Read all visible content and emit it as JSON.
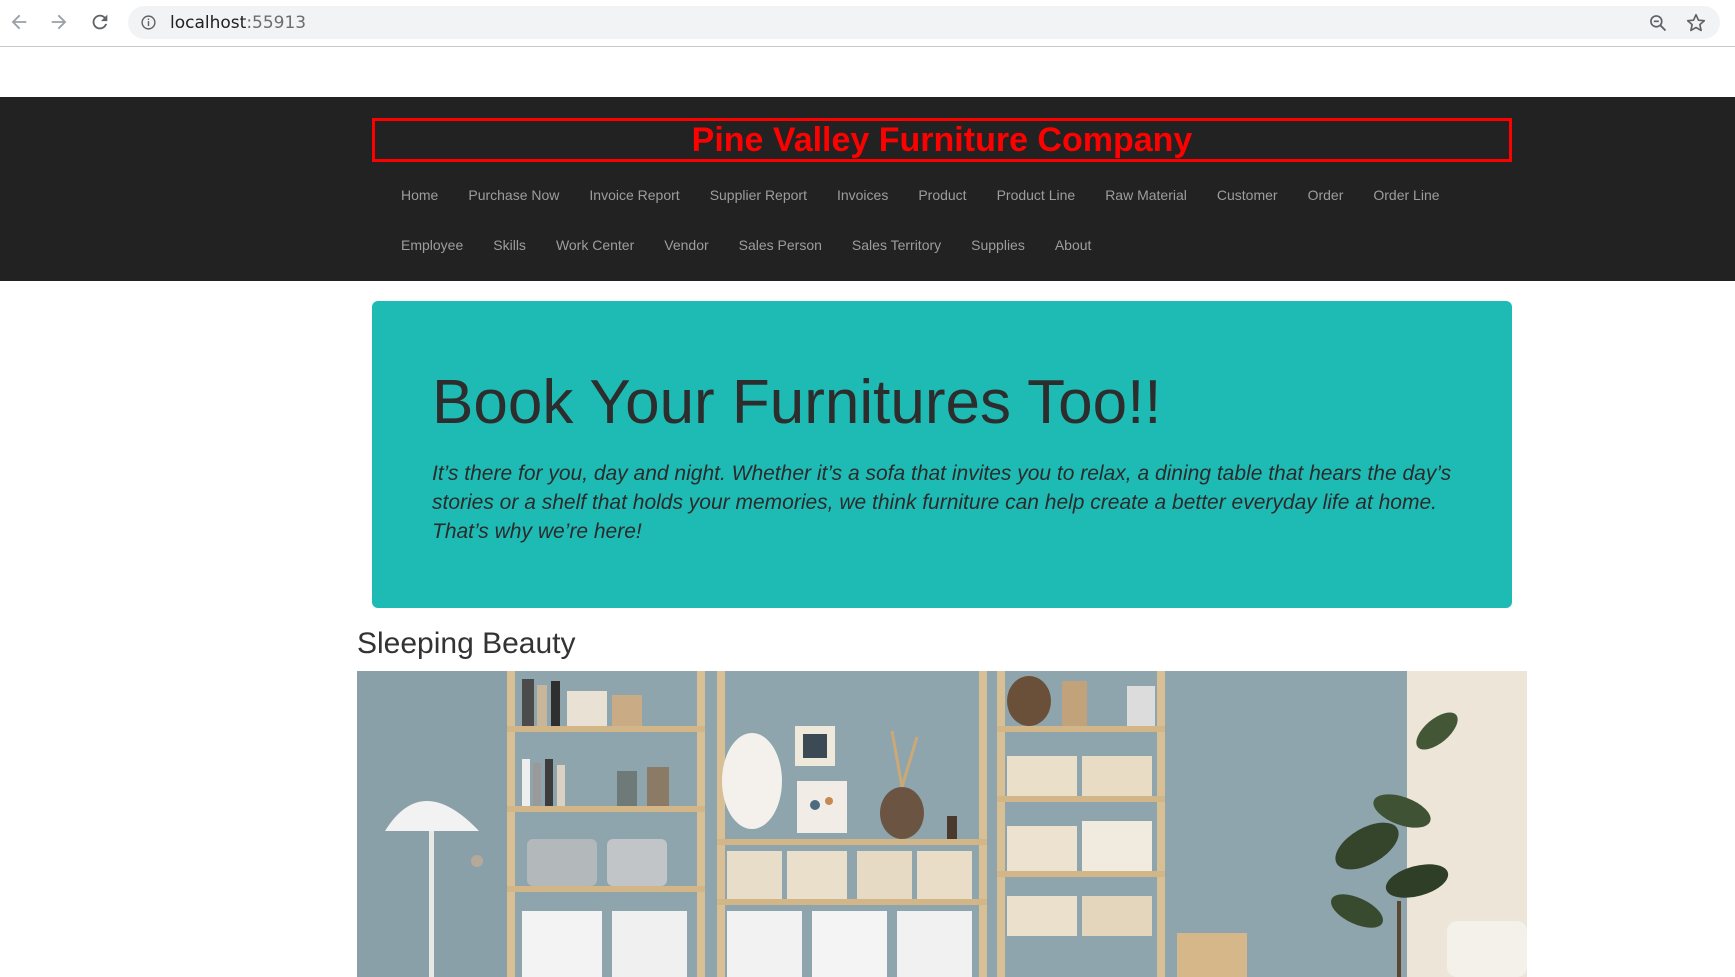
{
  "browser": {
    "url_host": "localhost",
    "url_port": ":55913"
  },
  "header": {
    "brand": "Pine Valley Furniture Company",
    "nav_row_1": [
      "Home",
      "Purchase Now",
      "Invoice Report",
      "Supplier Report",
      "Invoices",
      "Product",
      "Product Line",
      "Raw Material",
      "Customer",
      "Order",
      "Order Line"
    ],
    "nav_row_2": [
      "Employee",
      "Skills",
      "Work Center",
      "Vendor",
      "Sales Person",
      "Sales Territory",
      "Supplies",
      "About"
    ]
  },
  "hero": {
    "heading": "Book Your Furnitures Too!!",
    "text": "It’s there for you, day and night. Whether it’s a sofa that invites you to relax, a dining table that hears the day’s stories or a shelf that holds your memories, we think furniture can help create a better everyday life at home. That’s why we’re here!"
  },
  "section": {
    "title": "Sleeping Beauty"
  },
  "colors": {
    "navbar_bg": "#222222",
    "brand_red": "#ff0000",
    "hero_bg": "#1ebbb5"
  }
}
